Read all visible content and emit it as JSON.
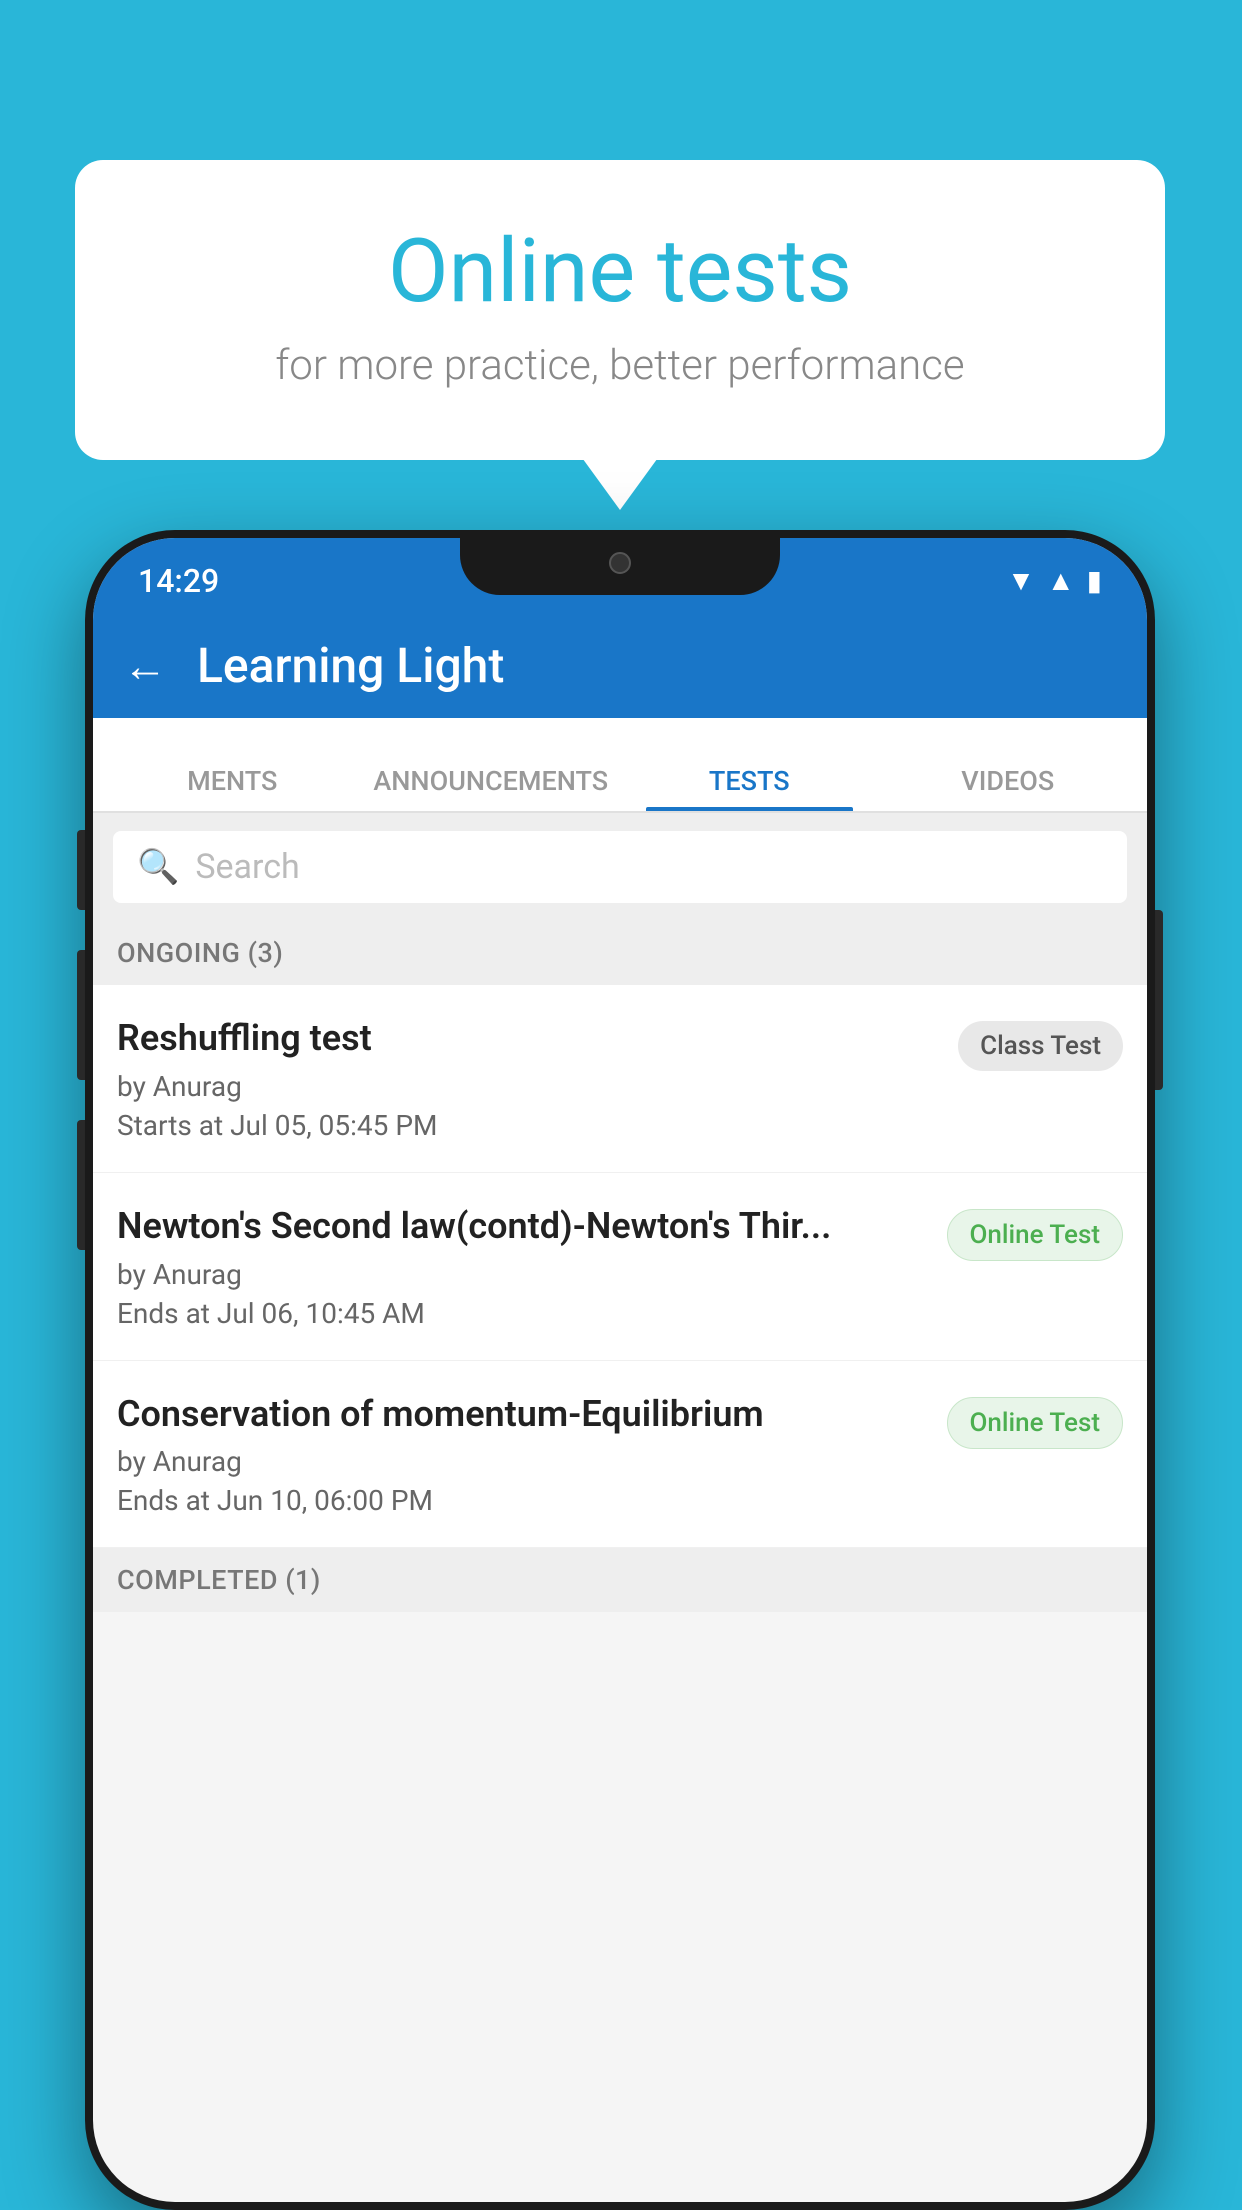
{
  "background_color": "#29b6d8",
  "bubble": {
    "title": "Online tests",
    "subtitle": "for more practice, better performance"
  },
  "phone": {
    "status_bar": {
      "time": "14:29",
      "icons": [
        "wifi",
        "signal",
        "battery"
      ]
    },
    "top_bar": {
      "back_label": "←",
      "title": "Learning Light"
    },
    "tabs": [
      {
        "label": "MENTS",
        "active": false
      },
      {
        "label": "ANNOUNCEMENTS",
        "active": false
      },
      {
        "label": "TESTS",
        "active": true
      },
      {
        "label": "VIDEOS",
        "active": false
      }
    ],
    "search": {
      "placeholder": "Search"
    },
    "section_ongoing": {
      "label": "ONGOING (3)"
    },
    "tests": [
      {
        "name": "Reshuffling test",
        "author": "by Anurag",
        "time_label": "Starts at",
        "time": "Jul 05, 05:45 PM",
        "badge": "Class Test",
        "badge_type": "class"
      },
      {
        "name": "Newton's Second law(contd)-Newton's Thir...",
        "author": "by Anurag",
        "time_label": "Ends at",
        "time": "Jul 06, 10:45 AM",
        "badge": "Online Test",
        "badge_type": "online"
      },
      {
        "name": "Conservation of momentum-Equilibrium",
        "author": "by Anurag",
        "time_label": "Ends at",
        "time": "Jun 10, 06:00 PM",
        "badge": "Online Test",
        "badge_type": "online"
      }
    ],
    "section_completed": {
      "label": "COMPLETED (1)"
    }
  }
}
